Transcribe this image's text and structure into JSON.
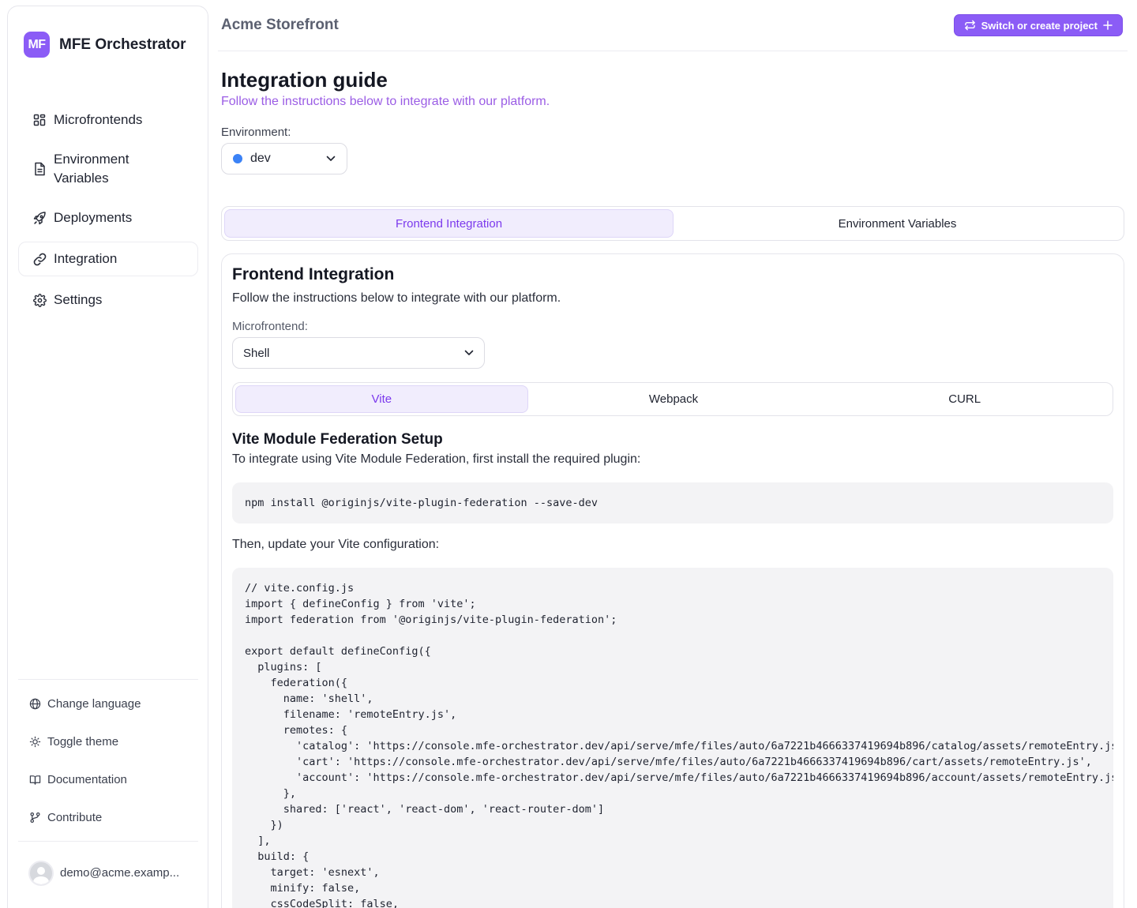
{
  "sidebar": {
    "logo_text": "MF",
    "app_name": "MFE Orchestrator",
    "nav": [
      {
        "label": "Microfrontends",
        "icon": "grid-icon"
      },
      {
        "label": "Environment Variables",
        "icon": "file-text-icon"
      },
      {
        "label": "Deployments",
        "icon": "rocket-icon"
      },
      {
        "label": "Integration",
        "icon": "link-icon",
        "active": true
      },
      {
        "label": "Settings",
        "icon": "gear-icon"
      }
    ],
    "footer": [
      {
        "label": "Change language",
        "icon": "globe-icon"
      },
      {
        "label": "Toggle theme",
        "icon": "sun-icon"
      },
      {
        "label": "Documentation",
        "icon": "book-icon"
      },
      {
        "label": "Contribute",
        "icon": "git-branch-icon"
      }
    ],
    "user_email": "demo@acme.examp..."
  },
  "header": {
    "project_name": "Acme Storefront",
    "switch_button": "Switch or create project"
  },
  "page": {
    "title": "Integration guide",
    "subtitle": "Follow the instructions below to integrate with our platform.",
    "environment_label": "Environment:",
    "environment_value": "dev",
    "tabs": [
      "Frontend Integration",
      "Environment Variables"
    ],
    "active_tab": "Frontend Integration"
  },
  "card": {
    "title": "Frontend Integration",
    "subtitle": "Follow the instructions below to integrate with our platform.",
    "microfrontend_label": "Microfrontend:",
    "microfrontend_value": "Shell",
    "tool_tabs": [
      "Vite",
      "Webpack",
      "CURL"
    ],
    "active_tool_tab": "Vite",
    "setup_title": "Vite Module Federation Setup",
    "setup_subtitle": "To integrate using Vite Module Federation, first install the required plugin:",
    "install_command": "npm install @originjs/vite-plugin-federation --save-dev",
    "then_text": "Then, update your Vite configuration:",
    "config_code": "// vite.config.js\nimport { defineConfig } from 'vite';\nimport federation from '@originjs/vite-plugin-federation';\n\nexport default defineConfig({\n  plugins: [\n    federation({\n      name: 'shell',\n      filename: 'remoteEntry.js',\n      remotes: {\n        'catalog': 'https://console.mfe-orchestrator.dev/api/serve/mfe/files/auto/6a7221b4666337419694b896/catalog/assets/remoteEntry.js',\n        'cart': 'https://console.mfe-orchestrator.dev/api/serve/mfe/files/auto/6a7221b4666337419694b896/cart/assets/remoteEntry.js',\n        'account': 'https://console.mfe-orchestrator.dev/api/serve/mfe/files/auto/6a7221b4666337419694b896/account/assets/remoteEntry.js',\n      },\n      shared: ['react', 'react-dom', 'react-router-dom']\n    })\n  ],\n  build: {\n    target: 'esnext',\n    minify: false,\n    cssCodeSplit: false,"
  },
  "colors": {
    "accent": "#8b5cf6",
    "env_dot": "#3b82f6"
  }
}
